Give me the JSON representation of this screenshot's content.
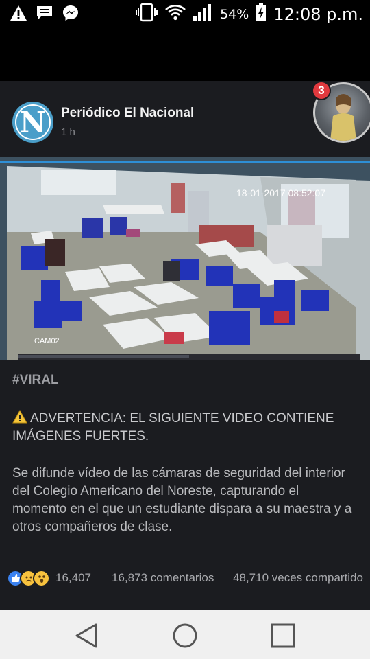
{
  "status_bar": {
    "battery": "54%",
    "time": "12:08 p.m.",
    "icons": [
      "warning-icon",
      "message-icon",
      "messenger-icon",
      "vibrate-icon",
      "wifi-icon",
      "signal-icon",
      "battery-charging-icon"
    ]
  },
  "post": {
    "page_name": "Periódico El Nacional",
    "time": "1 h",
    "video": {
      "timestamp": "18-01-2017 08:52:07",
      "camera_label": "CAM02"
    },
    "hashtag": "#VIRAL",
    "warning": "ADVERTENCIA: EL SIGUIENTE VIDEO CONTIENE IMÁGENES FUERTES.",
    "description": "Se difunde vídeo de las cámaras de seguridad del interior del Colegio Americano del Noreste, capturando el momento en el que un estudiante dispara a su maestra y a otros compañeros de clase.",
    "reactions_count": "16,407",
    "comments": "16,873 comentarios",
    "shares": "48,710 veces compartido",
    "reaction_icons": [
      "like-icon",
      "sad-icon",
      "wow-icon"
    ]
  },
  "chat_head": {
    "badge": "3"
  },
  "nav_bar": {
    "icons": [
      "back-icon",
      "home-icon",
      "recents-icon"
    ]
  },
  "colors": {
    "card_bg": "#1b1c20",
    "like_blue": "#3b82f0",
    "reaction_yellow": "#f7c23e",
    "badge_red": "#e0393e"
  }
}
